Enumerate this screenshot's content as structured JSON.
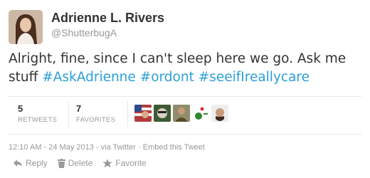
{
  "user": {
    "name": "Adrienne L. Rivers",
    "handle": "@ShutterbugA"
  },
  "tweet": {
    "text_plain": "Alright, fine, since I can't sleep here we go. Ask me stuff ",
    "hashtags": [
      "#AskAdrienne",
      "#ordont",
      "#seeifIreallycare"
    ]
  },
  "stats": {
    "retweets_count": "5",
    "retweets_label": "RETWEETS",
    "favorites_count": "7",
    "favorites_label": "FAVORITES"
  },
  "meta": {
    "timestamp": "12:10 AM - 24 May 2013",
    "via": " - via Twitter",
    "sep": " · ",
    "embed": "Embed this Tweet"
  },
  "actions": {
    "reply": "Reply",
    "delete": "Delete",
    "favorite": "Favorite"
  },
  "colors": {
    "hashtag": "#2a9fd6",
    "muted": "#999999"
  }
}
